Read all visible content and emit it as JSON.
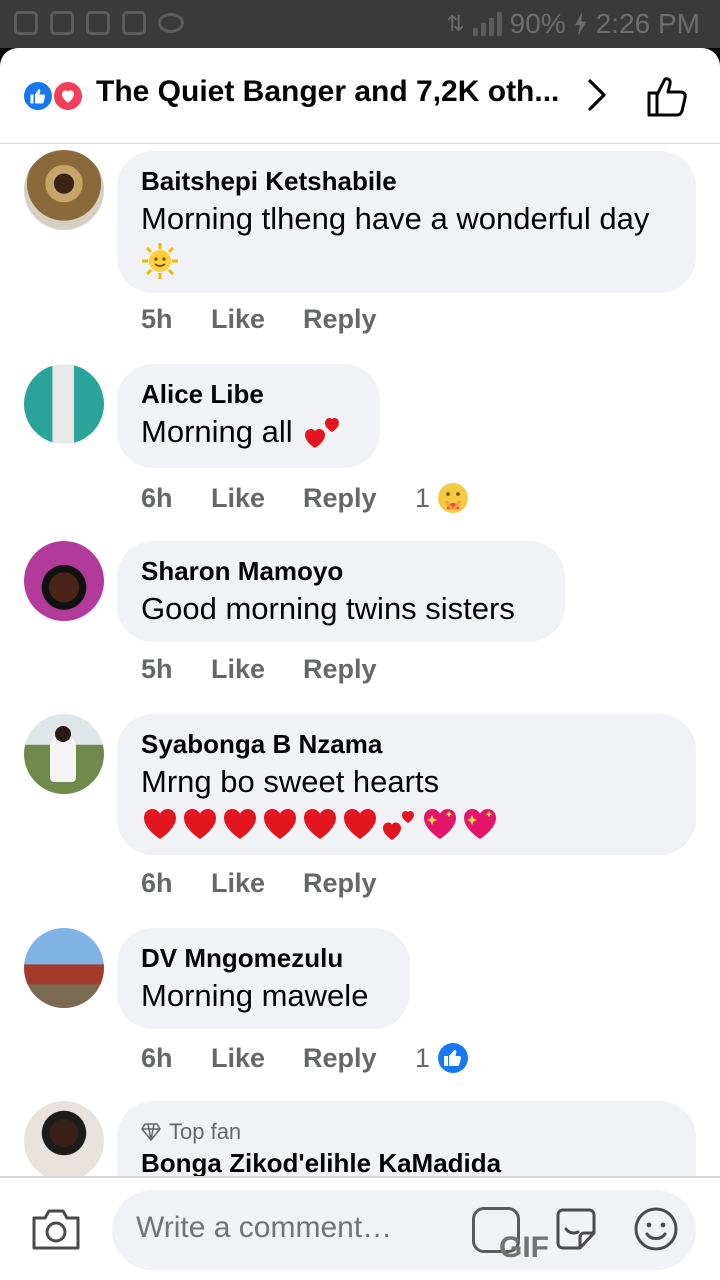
{
  "status_bar": {
    "battery": "90%",
    "time": "2:26 PM"
  },
  "header": {
    "title": "The Quiet Banger and 7,2K oth...",
    "reactions": [
      "like",
      "love"
    ]
  },
  "comments": [
    {
      "name": "Baitshepi Ketshabile",
      "text": "Morning tlheng have a wonderful day",
      "emojis": [
        "sun-with-face"
      ],
      "time": "5h",
      "like": "Like",
      "reply": "Reply"
    },
    {
      "name": "Alice Libe",
      "text": "Morning all",
      "emojis": [
        "two-hearts"
      ],
      "time": "6h",
      "like": "Like",
      "reply": "Reply",
      "reaction_count": "1",
      "reaction": "care"
    },
    {
      "name": "Sharon Mamoyo",
      "text": "Good morning twins sisters",
      "time": "5h",
      "like": "Like",
      "reply": "Reply"
    },
    {
      "name": "Syabonga B Nzama",
      "text": "Mrng bo sweet hearts",
      "emojis": [
        "red-heart",
        "red-heart",
        "red-heart",
        "red-heart",
        "red-heart",
        "red-heart",
        "two-hearts",
        "sparkling-heart",
        "sparkling-heart"
      ],
      "time": "6h",
      "like": "Like",
      "reply": "Reply"
    },
    {
      "name": "DV Mngomezulu",
      "text": "Morning mawele",
      "time": "6h",
      "like": "Like",
      "reply": "Reply",
      "reaction_count": "1",
      "reaction": "like"
    },
    {
      "badge": "Top fan",
      "name": "Bonga Zikod'elihle KaMadida"
    }
  ],
  "composer": {
    "placeholder": "Write a comment…",
    "gif_label": "GIF"
  },
  "colors": {
    "accent": "#1877f2",
    "love": "#f33e58",
    "bubble": "#f0f2f5",
    "muted": "#65676b"
  }
}
